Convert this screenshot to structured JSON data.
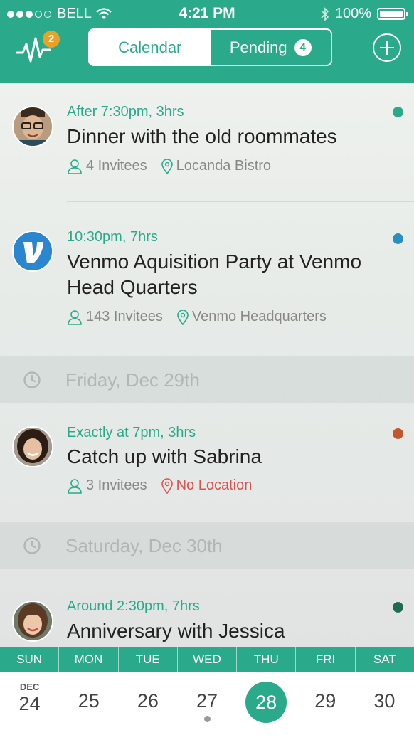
{
  "status_bar": {
    "carrier": "BELL",
    "time": "4:21 PM",
    "battery": "100%",
    "battery_level": 1.0
  },
  "header": {
    "activity_badge": "2",
    "tabs": [
      {
        "label": "Calendar",
        "active": true
      },
      {
        "label": "Pending",
        "count": "4",
        "active": false
      }
    ]
  },
  "events": [
    {
      "time": "After 7:30pm, 3hrs",
      "title": "Dinner with the old roommates",
      "invitees": "4 Invitees",
      "location": "Locanda Bistro",
      "dot_color": "#2aa98b"
    },
    {
      "time": "10:30pm, 7hrs",
      "title": "Venmo Aquisition Party at Venmo Head Quarters",
      "invitees": "143 Invitees",
      "location": "Venmo Headquarters",
      "dot_color": "#2a8ec1"
    },
    {
      "time": "Exactly at 7pm, 3hrs",
      "title": "Catch up with Sabrina",
      "invitees": "3 Invitees",
      "location": "No Location",
      "dot_color": "#c2572f"
    },
    {
      "time": "Around 2:30pm, 7hrs",
      "title": "Anniversary with Jessica",
      "dot_color": "#1e6b55"
    }
  ],
  "day_headers": [
    "Friday, Dec 29th",
    "Saturday, Dec 30th"
  ],
  "week": {
    "days": [
      "SUN",
      "MON",
      "TUE",
      "WED",
      "THU",
      "FRI",
      "SAT"
    ],
    "month": "DEC",
    "dates": [
      "24",
      "25",
      "26",
      "27",
      "28",
      "29",
      "30"
    ],
    "selected": "28"
  },
  "colors": {
    "accent": "#2aa98b",
    "danger": "#d9534f"
  }
}
